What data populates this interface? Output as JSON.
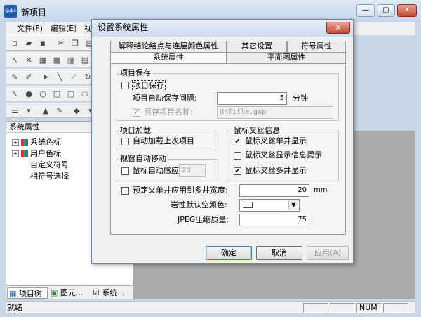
{
  "app": {
    "title": "新项目",
    "icon_text": "Qubx"
  },
  "window_buttons": [
    "—",
    "▢",
    "✕"
  ],
  "menu": {
    "items": [
      "文件(F)",
      "编辑(E)",
      "视图"
    ]
  },
  "side_panel": {
    "title": "系统属性",
    "tree": [
      {
        "label": "系统色标",
        "expander": "+"
      },
      {
        "label": "用户色标",
        "expander": "+"
      },
      {
        "label": "自定义符号"
      },
      {
        "label": "相符号选择"
      }
    ],
    "tabs": [
      "项目树",
      "图元...",
      "系统..."
    ]
  },
  "statusbar": {
    "text": "就绪",
    "num": "NUM"
  },
  "dialog": {
    "title": "设置系统属性",
    "close_label": "✕",
    "tabs_back": [
      "解释结论结点与连层颜色属性",
      "其它设置",
      "符号属性"
    ],
    "tabs_front": [
      "系统属性",
      "平面图属性"
    ],
    "project_save": {
      "title": "项目保存",
      "save_label": "项目保存",
      "interval_label": "项目自动保存间隔:",
      "interval_value": "5",
      "interval_unit": "分钟",
      "saveas_label": "另存项目名称:",
      "saveas_value": "UnTitle.gxp"
    },
    "project_load": {
      "title": "项目加载",
      "auto_load_label": "自动加载上次项目"
    },
    "window_move": {
      "title": "视窗自动移动",
      "mouse_sense_label": "鼠标自动感应",
      "mouse_sense_value": "20"
    },
    "crosshair": {
      "title": "鼠标叉丝信息",
      "items": [
        {
          "label": "鼠标叉丝单井显示",
          "checked": true
        },
        {
          "label": "鼠标叉丝显示信息提示",
          "checked": false
        },
        {
          "label": "鼠标叉丝多井显示",
          "checked": true
        }
      ]
    },
    "preset_width": {
      "label": "预定义单井应用到多井宽度:",
      "value": "20",
      "unit": "mm"
    },
    "empty_color": {
      "label": "岩性默认空颜色:"
    },
    "jpeg_quality": {
      "label": "JPEG压缩质量:",
      "value": "75"
    },
    "buttons": {
      "ok": "确定",
      "cancel": "取消",
      "apply": "应用(A)"
    }
  }
}
